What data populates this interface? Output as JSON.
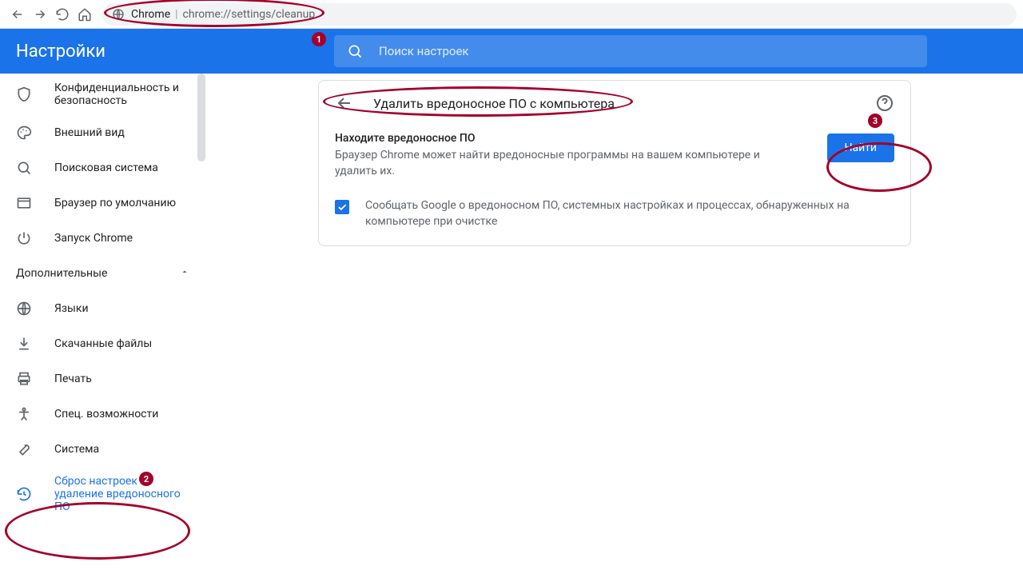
{
  "toolbar": {
    "url_seg1": "Chrome",
    "url_seg2": "chrome://settings/cleanup"
  },
  "header": {
    "title": "Настройки",
    "search_placeholder": "Поиск настроек"
  },
  "sidebar": {
    "items": [
      {
        "label": "Конфиденциальность и безопасность"
      },
      {
        "label": "Внешний вид"
      },
      {
        "label": "Поисковая система"
      },
      {
        "label": "Браузер по умолчанию"
      },
      {
        "label": "Запуск Chrome"
      }
    ],
    "section": "Дополнительные",
    "items2": [
      {
        "label": "Языки"
      },
      {
        "label": "Скачанные файлы"
      },
      {
        "label": "Печать"
      },
      {
        "label": "Спец. возможности"
      },
      {
        "label": "Система"
      },
      {
        "label": "Сброс настроек и удаление вредоносного ПО"
      }
    ]
  },
  "panel": {
    "title": "Удалить вредоносное ПО с компьютера",
    "section_title": "Находите вредоносное ПО",
    "section_desc": "Браузер Chrome может найти вредоносные программы на вашем компьютере и удалить их.",
    "find_button": "Найти",
    "checkbox_label": "Сообщать Google о вредоносном ПО, системных настройках и процессах, обнаруженных на компьютере при очистке"
  },
  "annotations": {
    "b1": "1",
    "b2": "2",
    "b3": "3"
  }
}
